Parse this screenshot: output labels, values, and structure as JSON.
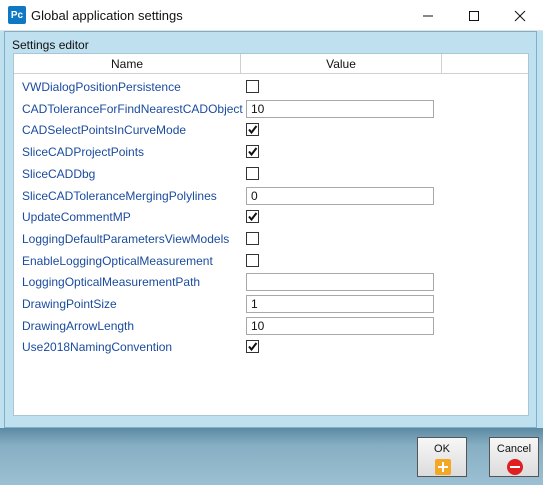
{
  "window": {
    "app_icon_text": "Pc",
    "title": "Global application settings"
  },
  "group": {
    "label": "Settings editor"
  },
  "grid": {
    "headers": {
      "name": "Name",
      "value": "Value"
    },
    "rows": [
      {
        "name": "VWDialogPositionPersistence",
        "type": "checkbox",
        "checked": false
      },
      {
        "name": "CADToleranceForFindNearestCADObject",
        "type": "text",
        "value": "10"
      },
      {
        "name": "CADSelectPointsInCurveMode",
        "type": "checkbox",
        "checked": true
      },
      {
        "name": "SliceCADProjectPoints",
        "type": "checkbox",
        "checked": true
      },
      {
        "name": "SliceCADDbg",
        "type": "checkbox",
        "checked": false
      },
      {
        "name": "SliceCADToleranceMergingPolylines",
        "type": "text",
        "value": "0"
      },
      {
        "name": "UpdateCommentMP",
        "type": "checkbox",
        "checked": true
      },
      {
        "name": "LoggingDefaultParametersViewModels",
        "type": "checkbox",
        "checked": false
      },
      {
        "name": "EnableLoggingOpticalMeasurement",
        "type": "checkbox",
        "checked": false
      },
      {
        "name": "LoggingOpticalMeasurementPath",
        "type": "text",
        "value": ""
      },
      {
        "name": "DrawingPointSize",
        "type": "text",
        "value": "1"
      },
      {
        "name": "DrawingArrowLength",
        "type": "text",
        "value": "10"
      },
      {
        "name": "Use2018NamingConvention",
        "type": "checkbox",
        "checked": true
      }
    ]
  },
  "footer": {
    "ok_label": "OK",
    "cancel_label": "Cancel"
  },
  "colors": {
    "accent": "#0f78c4",
    "label_text": "#1a4b9e",
    "ok_icon": "#f5a623",
    "cancel_icon": "#e02020"
  },
  "icons": {
    "minimize": "minimize-icon",
    "maximize": "maximize-icon",
    "close": "close-icon",
    "ok": "plus-icon",
    "cancel": "minus-icon"
  }
}
